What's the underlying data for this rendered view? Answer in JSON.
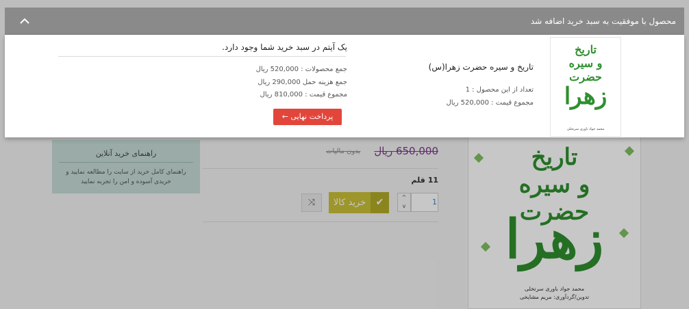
{
  "notification": {
    "title": "محصول با موفقیت به سبد خرید اضافه شد",
    "collapse_icon": "^"
  },
  "added_product": {
    "name": "تاریخ و سیره حضرت زهرا(س)",
    "count_text": "تعداد از این محصول : 1",
    "total_text": "مجموع قیمت : 520,000 ریال",
    "cover": {
      "title_line1": "تاریخ",
      "title_line2": "و سیره",
      "title_line3": "حضرت",
      "big": "زهرا",
      "author": "محمد جواد باوری سرتخلی"
    }
  },
  "cart_summary": {
    "message": "یک آیتم در سبد خرید شما وجود دارد.",
    "products_total": "جمع محصولات : 520,000 ریال",
    "shipping_total": "جمع هزینه حمل  290,000 ریال",
    "grand_total": "مجموع قیمت : 810,000 ریال",
    "checkout_label": "پرداخت نهایی ←"
  },
  "product_page": {
    "old_price": "650,000 ریال",
    "price_note": "بدون مالیات",
    "stock_text": "11 قلم",
    "quantity_value": "1",
    "stepper_up": "^",
    "stepper_down": "v",
    "buy_label": "خرید کالا",
    "buy_check_icon": "✔",
    "compare_icon": "⤨",
    "cover": {
      "title_line1": "تاریخ",
      "title_line2": "و سیره",
      "title_line3": "حضرت",
      "big": "زهرا",
      "author_line1": "محمد جواد باوری سرتخلی",
      "author_line2": "تدوین/گردآوری: مریم مشایخی"
    }
  },
  "guide": {
    "title": "راهنمای خرید آنلاین",
    "text": "راهنمای کامل خرید از سایت را مطالعه نمایید و خریدی آسوده و امن را تجربه نمایید"
  },
  "colors": {
    "bar": "#8a8a8a",
    "checkout": "#e2463b",
    "buy": "#c9c037",
    "guide": "#c6dcd8",
    "price": "#7a3b8a"
  }
}
